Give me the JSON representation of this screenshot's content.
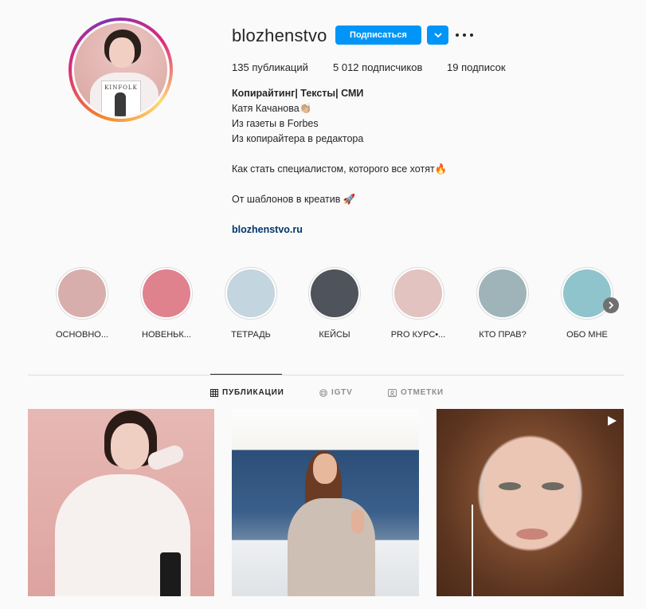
{
  "profile": {
    "username": "blozhenstvo",
    "follow_label": "Подписаться",
    "stats": {
      "posts": "135",
      "posts_label": "публикаций",
      "followers": "5 012",
      "followers_label": "подписчиков",
      "following": "19",
      "following_label": "подписок"
    },
    "bio": {
      "name": "Копирайтинг| Тексты| СМИ",
      "line1": "Катя Качанова👏🏼",
      "line2": "Из газеты в Forbes",
      "line3": "Из копирайтера в редактора",
      "line4": "Как стать специалистом, которого все хотят🔥",
      "line5": "От шаблонов в креатив 🚀",
      "link": "blozhenstvo.ru"
    },
    "avatar_magazine_text": "KINFOLK"
  },
  "highlights": [
    {
      "label": "ОСНОВНО...",
      "color": "#d7aeac"
    },
    {
      "label": "НОВЕНЬК...",
      "color": "#e0818e"
    },
    {
      "label": "ТЕТРАДЬ",
      "color": "#c3d5de"
    },
    {
      "label": "КЕЙСЫ",
      "color": "#4e535c"
    },
    {
      "label": "PRO КУРС•...",
      "color": "#e3c3bf"
    },
    {
      "label": "КТО ПРАВ?",
      "color": "#9fb4b9"
    },
    {
      "label": "ОБО МНЕ",
      "color": "#90c4cc"
    }
  ],
  "tabs": [
    {
      "label": "ПУБЛИКАЦИИ",
      "icon": "grid-icon",
      "active": true
    },
    {
      "label": "IGTV",
      "icon": "igtv-icon",
      "active": false
    },
    {
      "label": "ОТМЕТКИ",
      "icon": "tagged-icon",
      "active": false
    }
  ],
  "posts": [
    {
      "type": "photo"
    },
    {
      "type": "photo"
    },
    {
      "type": "video",
      "icon": "play-icon"
    }
  ],
  "colors": {
    "accent": "#0095f6",
    "link": "#00376b",
    "background": "#fafafa"
  }
}
